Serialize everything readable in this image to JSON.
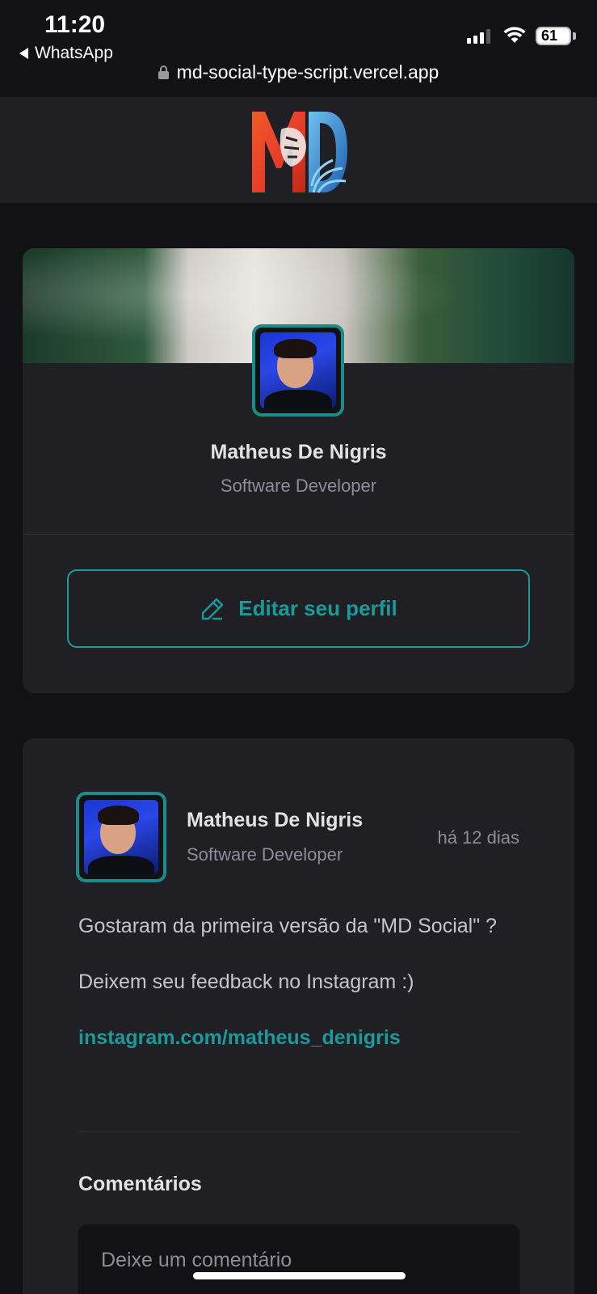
{
  "status_bar": {
    "time": "11:20",
    "back_app": "WhatsApp",
    "battery": "61",
    "url": "md-social-type-script.vercel.app"
  },
  "header": {
    "logo_alt": "MD"
  },
  "profile": {
    "name": "Matheus De Nigris",
    "role": "Software Developer",
    "edit_label": "Editar seu perfil"
  },
  "post": {
    "author_name": "Matheus De Nigris",
    "author_role": "Software Developer",
    "time": "há 12 dias",
    "paragraph_1": "Gostaram da primeira versão da \"MD Social\" ?",
    "paragraph_2": "Deixem seu feedback no Instagram :)",
    "link": "instagram.com/matheus_denigris",
    "comments_title": "Comentários",
    "comment_placeholder": "Deixe um comentário"
  },
  "colors": {
    "accent": "#1a9a9a",
    "background": "#121214",
    "card": "#202024"
  }
}
